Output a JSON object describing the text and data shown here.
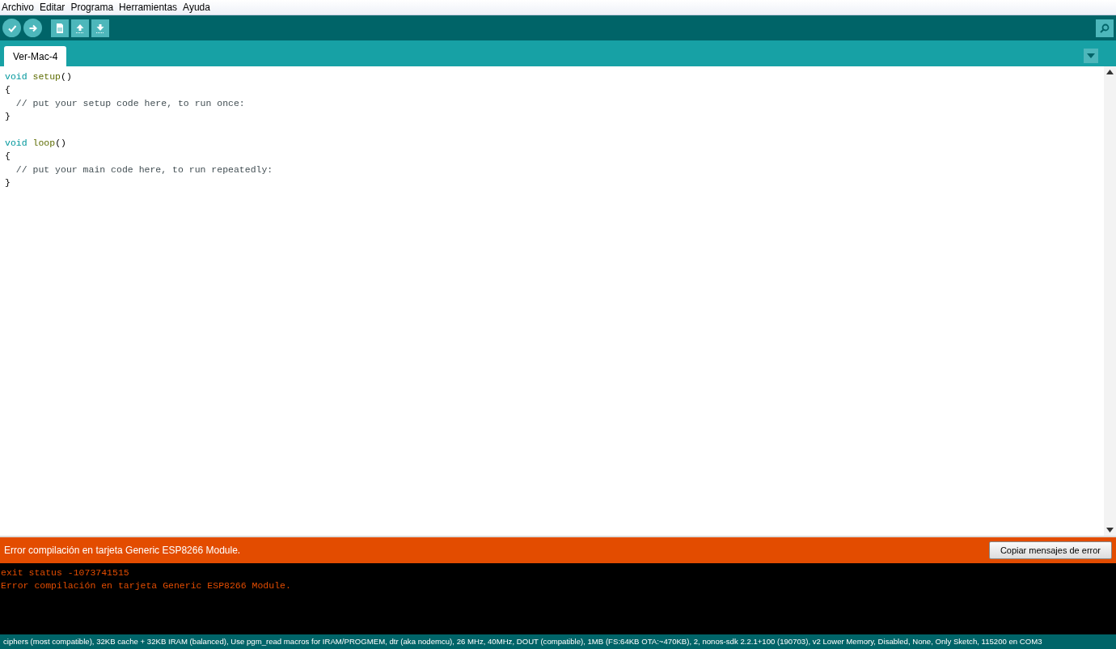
{
  "menu": [
    "Archivo",
    "Editar",
    "Programa",
    "Herramientas",
    "Ayuda"
  ],
  "toolbar": [
    {
      "kind": "verify"
    },
    {
      "kind": "upload"
    },
    {
      "kind": "new"
    },
    {
      "kind": "open"
    },
    {
      "kind": "save"
    }
  ],
  "tabs": [
    {
      "label": "Ver-Mac-4",
      "selected": true
    }
  ],
  "editor": {
    "lines": [
      {
        "kind": "code",
        "tokens": [
          {
            "text": "void",
            "kind": "keyword"
          },
          {
            "text": "setup",
            "kind": "function"
          },
          {
            "text": "()",
            "kind": "plain"
          }
        ]
      },
      {
        "kind": "code",
        "tokens": [
          {
            "text": "{",
            "kind": "plain"
          }
        ]
      },
      {
        "kind": "code",
        "tokens": [
          {
            "text": "  // put your setup code here, to run once:",
            "kind": "comment"
          }
        ]
      },
      {
        "kind": "code",
        "tokens": [
          {
            "text": "}",
            "kind": "plain"
          }
        ]
      },
      {
        "kind": "blank"
      },
      {
        "kind": "code",
        "tokens": [
          {
            "text": "void",
            "kind": "keyword"
          },
          {
            "text": "loop",
            "kind": "function"
          },
          {
            "text": "()",
            "kind": "plain"
          }
        ]
      },
      {
        "kind": "code",
        "tokens": [
          {
            "text": "{",
            "kind": "plain"
          }
        ]
      },
      {
        "kind": "code",
        "tokens": [
          {
            "text": "  // put your main code here, to run repeatedly:",
            "kind": "comment"
          }
        ]
      },
      {
        "kind": "code",
        "tokens": [
          {
            "text": "}",
            "kind": "plain"
          }
        ]
      }
    ]
  },
  "error_bar": {
    "message": "Error compilación en tarjeta Generic ESP8266 Module.",
    "button": "Copiar mensajes de error"
  },
  "console": [
    "exit status -1073741515",
    "Error compilación en tarjeta Generic ESP8266 Module."
  ],
  "status_bar": "ciphers (most compatible), 32KB cache + 32KB IRAM (balanced), Use pgm_read macros for IRAM/PROGMEM, dtr (aka nodemcu), 26 MHz, 40MHz, DOUT (compatible), 1MB (FS:64KB OTA:~470KB), 2, nonos-sdk 2.2.1+100 (190703), v2 Lower Memory, Disabled, None, Only Sketch, 115200 en COM3"
}
